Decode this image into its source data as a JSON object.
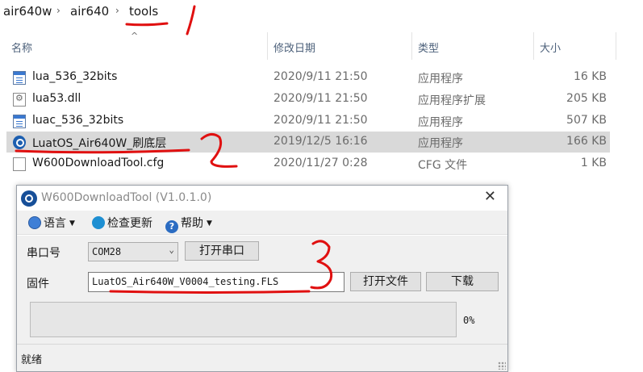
{
  "breadcrumb": {
    "items": [
      "air640w",
      "air640",
      "tools"
    ]
  },
  "columns": {
    "name": "名称",
    "modified": "修改日期",
    "type": "类型",
    "size": "大小"
  },
  "files": [
    {
      "name": "lua_536_32bits",
      "modified": "2020/9/11 21:50",
      "type": "应用程序",
      "size": "16 KB",
      "icon": "application-icon"
    },
    {
      "name": "lua53.dll",
      "modified": "2020/9/11 21:50",
      "type": "应用程序扩展",
      "size": "205 KB",
      "icon": "dll-icon"
    },
    {
      "name": "luac_536_32bits",
      "modified": "2020/9/11 21:50",
      "type": "应用程序",
      "size": "507 KB",
      "icon": "application-icon"
    },
    {
      "name": "LuatOS_Air640W_刷底层",
      "modified": "2019/12/5 16:16",
      "type": "应用程序",
      "size": "166 KB",
      "icon": "luat-app-icon",
      "selected": true
    },
    {
      "name": "W600DownloadTool.cfg",
      "modified": "2020/11/27 0:28",
      "type": "CFG 文件",
      "size": "1 KB",
      "icon": "document-icon"
    }
  ],
  "tool": {
    "title": "W600DownloadTool (V1.0.1.0)",
    "menu": {
      "language": "语言",
      "check_update": "检查更新",
      "help": "帮助",
      "help_glyph": "?"
    },
    "port_label": "串口号",
    "port_value": "COM28",
    "open_port": "打开串口",
    "firmware_label": "固件",
    "firmware_path": "LuatOS_Air640W_V0004_testing.FLS",
    "open_file": "打开文件",
    "download": "下载",
    "progress": 0,
    "progress_text": "0%",
    "status": "就绪"
  },
  "annotations": {
    "color": "#e01010",
    "marks": [
      "1",
      "2",
      "3"
    ]
  }
}
